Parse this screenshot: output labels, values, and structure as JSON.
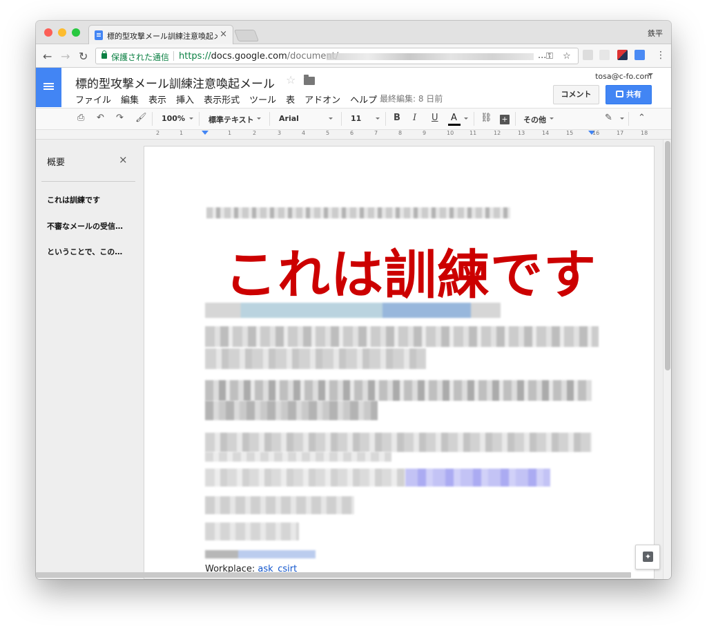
{
  "browser": {
    "tab_title": "標的型攻撃メール訓練注意喚起メ-",
    "tab_close": "×",
    "profile_name": "鉄平",
    "secure_label": "保護された通信",
    "url_scheme": "https://",
    "url_host": "docs.google.com",
    "url_path": "/document/",
    "url_ellipsis": "..."
  },
  "docs": {
    "title": "標的型攻撃メール訓練注意喚起メール",
    "star": "☆",
    "menu": [
      "ファイル",
      "編集",
      "表示",
      "挿入",
      "表示形式",
      "ツール",
      "表",
      "アドオン",
      "ヘルプ"
    ],
    "last_edit": "最終編集: 8 日前",
    "account_email": "tosa@c-fo.com",
    "comment_label": "コメント",
    "share_label": "共有"
  },
  "toolbar": {
    "zoom": "100%",
    "style": "標準テキスト",
    "font": "Arial",
    "size": "11",
    "bold": "B",
    "italic": "I",
    "underline": "U",
    "text_color": "A",
    "more": "その他"
  },
  "ruler": {
    "ticks": [
      "2",
      "1",
      "1",
      "2",
      "3",
      "4",
      "5",
      "6",
      "7",
      "8",
      "9",
      "10",
      "11",
      "12",
      "13",
      "14",
      "15",
      "16",
      "17",
      "18"
    ]
  },
  "outline": {
    "title": "概要",
    "close": "×",
    "items": [
      "これは訓練です",
      "不審なメールの受信…",
      "ということで、この…"
    ]
  },
  "document": {
    "heading": "これは訓練です",
    "heading_color": "#cc0000",
    "footer_prefix": "Workplace: ",
    "footer_link": "ask_csirt"
  }
}
